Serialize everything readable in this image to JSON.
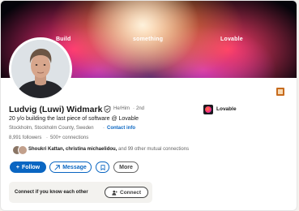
{
  "banner": {
    "words": [
      "Build",
      "something",
      "Lovable"
    ]
  },
  "profile": {
    "name": "Ludvig (Luwi) Widmark",
    "pronouns": "He/Him",
    "degree_separator": "·",
    "degree": "2nd",
    "headline": "20 y/o building the last piece of software @ Lovable",
    "location": "Stockholm, Stockholm County, Sweden",
    "location_separator": "·",
    "contact_info": "Contact info",
    "followers": "8,991 followers",
    "connections_separator": "·",
    "connections": "500+ connections",
    "mutual_names": "Shoukri Kattan, christina michaelidou,",
    "mutual_rest": "and 99 other mutual connections"
  },
  "company": {
    "name": "Lovable",
    "logo_icon": "lovable-heart-logo"
  },
  "actions": {
    "follow": "Follow",
    "follow_prefix": "+",
    "message": "Message",
    "save_icon": "bookmark-icon",
    "more": "More"
  },
  "connect_prompt": {
    "text": "Connect if you know each other",
    "button": "Connect"
  },
  "colors": {
    "primary": "#0a66c2",
    "text": "#191919",
    "muted": "#666666"
  }
}
